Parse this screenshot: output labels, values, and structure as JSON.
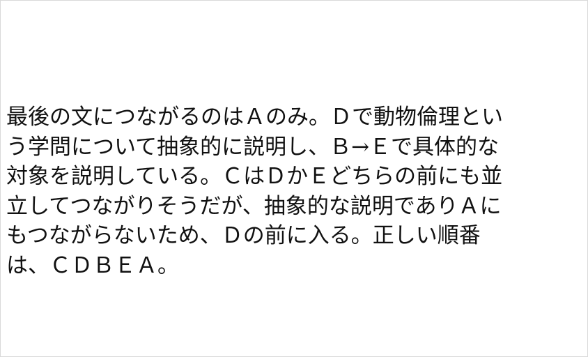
{
  "document": {
    "lines": [
      "最後の文につながるのはＡのみ。Ｄで動物倫理とい",
      "う学問について抽象的に説明し、Ｂ→Ｅで具体的な",
      "対象を説明している。ＣはＤかＥどちらの前にも並",
      "立してつながりそうだが、抽象的な説明でありＡに",
      "もつながらないため、Ｄの前に入る。正しい順番",
      "は、ＣＤＢＥＡ。"
    ]
  }
}
